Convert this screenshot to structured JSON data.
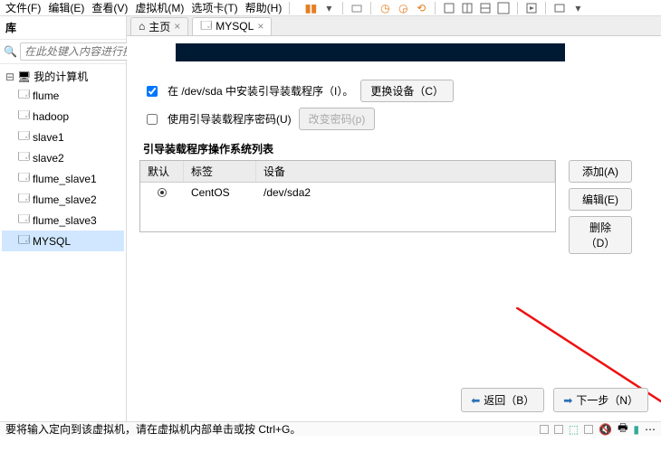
{
  "menubar": [
    "文件(F)",
    "编辑(E)",
    "查看(V)",
    "虚拟机(M)",
    "选项卡(T)",
    "帮助(H)"
  ],
  "sidebar": {
    "title": "库",
    "search_placeholder": "在此处键入内容进行搜索",
    "root": "我的计算机",
    "items": [
      "flume",
      "hadoop",
      "slave1",
      "slave2",
      "flume_slave1",
      "flume_slave2",
      "flume_slave3",
      "MYSQL"
    ]
  },
  "tabs": {
    "home": "主页",
    "active": "MYSQL"
  },
  "install": {
    "checkbox1_checked": true,
    "label1": "在 /dev/sda 中安装引导装载程序（I）。",
    "btn_changedev": "更换设备（C）",
    "checkbox2_checked": false,
    "label2": "使用引导装载程序密码(U)",
    "btn_changepwd": "改变密码(p)",
    "section": "引导装载程序操作系统列表",
    "th": {
      "c1": "默认",
      "c2": "标签",
      "c3": "设备"
    },
    "row": {
      "label": "CentOS",
      "device": "/dev/sda2"
    },
    "btns": {
      "add": "添加(A)",
      "edit": "编辑(E)",
      "del": "删除（D）"
    },
    "back": "返回（B）",
    "next": "下一步（N）"
  },
  "status": "要将输入定向到该虚拟机，请在虚拟机内部单击或按 Ctrl+G。"
}
